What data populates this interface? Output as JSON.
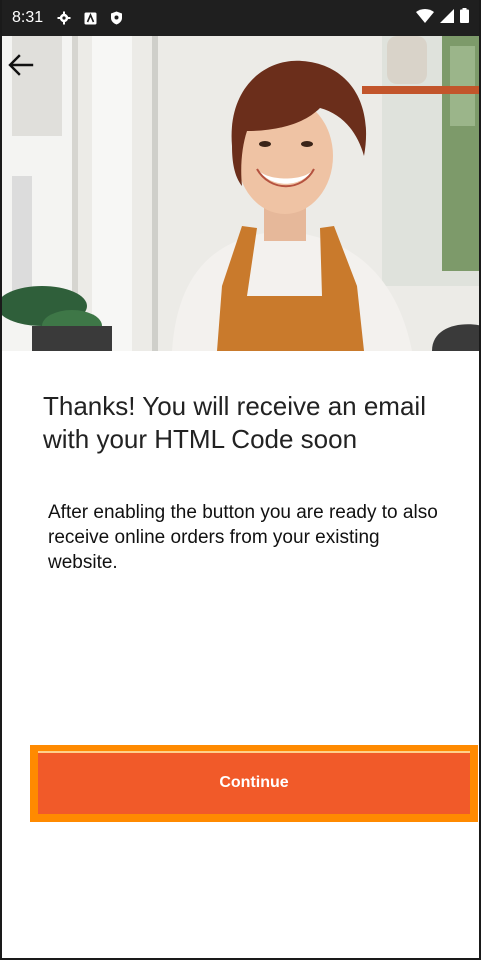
{
  "status_bar": {
    "time": "8:31",
    "icons_left": [
      "gear-icon",
      "a-box-icon",
      "shield-icon"
    ],
    "icons_right": [
      "wifi-icon",
      "cell-signal-icon",
      "battery-icon"
    ]
  },
  "navigation": {
    "back_icon": "arrow-left-icon"
  },
  "content": {
    "headline": "Thanks! You will receive an email with your HTML Code soon",
    "body": "After enabling the button you are ready to also receive online orders from your existing website."
  },
  "actions": {
    "continue_label": "Continue"
  },
  "colors": {
    "status_bar": "#1f1f1f",
    "button": "#f15a29",
    "button_highlight": "#ff8a00",
    "text": "#222222"
  }
}
